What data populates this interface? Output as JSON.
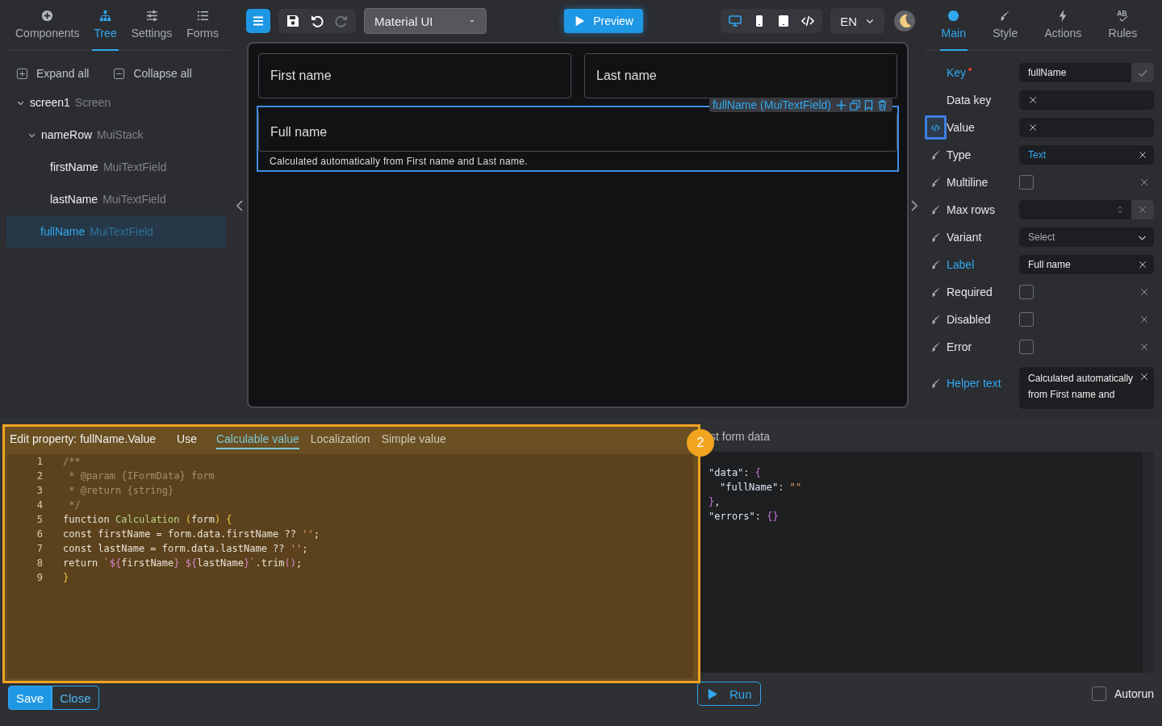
{
  "left_tabs": [
    {
      "label": "Components",
      "selected": false
    },
    {
      "label": "Tree",
      "selected": true
    },
    {
      "label": "Settings",
      "selected": false
    },
    {
      "label": "Forms",
      "selected": false
    }
  ],
  "tree_actions": [
    "Expand all",
    "Collapse all"
  ],
  "tree": [
    {
      "name": "screen1",
      "type": "Screen",
      "expanded": true,
      "selected": false,
      "children": [
        {
          "name": "nameRow",
          "type": "MuiStack",
          "expanded": true,
          "selected": false,
          "children": [
            {
              "name": "firstName",
              "type": "MuiTextField",
              "selected": false
            },
            {
              "name": "lastName",
              "type": "MuiTextField",
              "selected": false
            }
          ]
        },
        {
          "name": "fullName",
          "type": "MuiTextField",
          "selected": true
        }
      ]
    }
  ],
  "toolbar": {
    "theme": "Material UI",
    "preview": "Preview",
    "devices": [
      {
        "kind": "desktop",
        "selected": true
      },
      {
        "kind": "phone",
        "selected": false
      },
      {
        "kind": "tablet",
        "selected": false
      },
      {
        "kind": "code",
        "selected": false
      }
    ],
    "language": "EN"
  },
  "canvas": {
    "rows": [
      [
        {
          "label": "First name",
          "selected": false
        },
        {
          "label": "Last name",
          "selected": false
        }
      ],
      [
        {
          "label": "Full name",
          "helper": "Calculated automatically from First name and Last name.",
          "selected": true,
          "tag": "fullName (MuiTextField)"
        }
      ]
    ]
  },
  "right_tabs": [
    {
      "label": "Main",
      "selected": true
    },
    {
      "label": "Style",
      "selected": false
    },
    {
      "label": "Actions",
      "selected": false
    },
    {
      "label": "Rules",
      "selected": false
    }
  ],
  "properties": [
    {
      "kind": "key",
      "label": "Key",
      "modified": true,
      "required": true,
      "value": "fullName"
    },
    {
      "kind": "text",
      "label": "Data key",
      "modified": false
    },
    {
      "kind": "text",
      "label": "Value",
      "modified": false,
      "focused": true
    },
    {
      "kind": "choice",
      "label": "Type",
      "modified": false,
      "value": "Text"
    },
    {
      "kind": "checkbox",
      "label": "Multiline",
      "modified": false,
      "checked": false
    },
    {
      "kind": "number",
      "label": "Max rows",
      "modified": false
    },
    {
      "kind": "select",
      "label": "Variant",
      "modified": false,
      "placeholder": "Select"
    },
    {
      "kind": "text",
      "label": "Label",
      "modified": true,
      "value": "Full name"
    },
    {
      "kind": "checkbox",
      "label": "Required",
      "modified": false,
      "checked": false
    },
    {
      "kind": "checkbox",
      "label": "Disabled",
      "modified": false,
      "checked": false
    },
    {
      "kind": "checkbox",
      "label": "Error",
      "modified": false,
      "checked": false
    },
    {
      "kind": "textarea",
      "label": "Helper text",
      "modified": true,
      "value": "Calculated automatically from First name and"
    }
  ],
  "editor": {
    "title": "Edit property: fullName.Value",
    "use_label": "Use",
    "tabs": [
      {
        "label": "Calculable value",
        "selected": true
      },
      {
        "label": "Localization",
        "selected": false
      },
      {
        "label": "Simple value",
        "selected": false
      }
    ],
    "step": "2",
    "lines": [
      {
        "number": "1",
        "tokens": [
          {
            "kind": "comment",
            "text": "/**"
          }
        ]
      },
      {
        "number": "2",
        "tokens": [
          {
            "kind": "comment",
            "text": " * @param {IFormData} form"
          }
        ]
      },
      {
        "number": "3",
        "tokens": [
          {
            "kind": "comment",
            "text": " * @return {string}"
          }
        ]
      },
      {
        "number": "4",
        "tokens": [
          {
            "kind": "comment",
            "text": " */"
          }
        ]
      },
      {
        "number": "5",
        "tokens": [
          {
            "kind": "plain",
            "text": "function "
          },
          {
            "kind": "func",
            "text": "Calculation"
          },
          {
            "kind": "bracket",
            "text": " ("
          },
          {
            "kind": "plain",
            "text": "form"
          },
          {
            "kind": "bracket",
            "text": ") {"
          }
        ]
      },
      {
        "number": "6",
        "tokens": [
          {
            "kind": "plain",
            "text": "const firstName = form.data.firstName ?? "
          },
          {
            "kind": "string",
            "text": "''"
          },
          {
            "kind": "plain",
            "text": ";"
          }
        ]
      },
      {
        "number": "7",
        "tokens": [
          {
            "kind": "plain",
            "text": "const lastName = form.data.lastName ?? "
          },
          {
            "kind": "string",
            "text": "''"
          },
          {
            "kind": "plain",
            "text": ";"
          }
        ]
      },
      {
        "number": "8",
        "tokens": [
          {
            "kind": "plain",
            "text": "return "
          },
          {
            "kind": "string",
            "text": "`"
          },
          {
            "kind": "template",
            "text": "${"
          },
          {
            "kind": "plain",
            "text": "firstName"
          },
          {
            "kind": "template",
            "text": "} ${"
          },
          {
            "kind": "plain",
            "text": "lastName"
          },
          {
            "kind": "template",
            "text": "}"
          },
          {
            "kind": "string",
            "text": "`"
          },
          {
            "kind": "plain",
            "text": ".trim"
          },
          {
            "kind": "template",
            "text": "()"
          },
          {
            "kind": "plain",
            "text": ";"
          }
        ]
      },
      {
        "number": "9",
        "tokens": [
          {
            "kind": "bracket",
            "text": "}"
          }
        ]
      }
    ],
    "buttons": [
      "Save",
      "Close"
    ]
  },
  "test_panel": {
    "title": "st form data",
    "lines": [
      {
        "tokens": [
          {
            "kind": "key",
            "text": "\"data\""
          },
          {
            "kind": "plain",
            "text": ": "
          },
          {
            "kind": "brace",
            "text": "{"
          }
        ],
        "children": [
          {
            "tokens": [
              {
                "kind": "key",
                "text": "\"fullName\""
              },
              {
                "kind": "plain",
                "text": ": "
              },
              {
                "kind": "string",
                "text": "\"\""
              }
            ]
          }
        ]
      },
      {
        "tokens": [
          {
            "kind": "brace",
            "text": "}"
          },
          {
            "kind": "plain",
            "text": ","
          }
        ]
      },
      {
        "tokens": [
          {
            "kind": "key",
            "text": "\"errors\""
          },
          {
            "kind": "plain",
            "text": ": "
          },
          {
            "kind": "brace",
            "text": "{}"
          }
        ]
      }
    ],
    "run": "Run",
    "autorun": {
      "label": "Autorun",
      "checked": false
    }
  }
}
